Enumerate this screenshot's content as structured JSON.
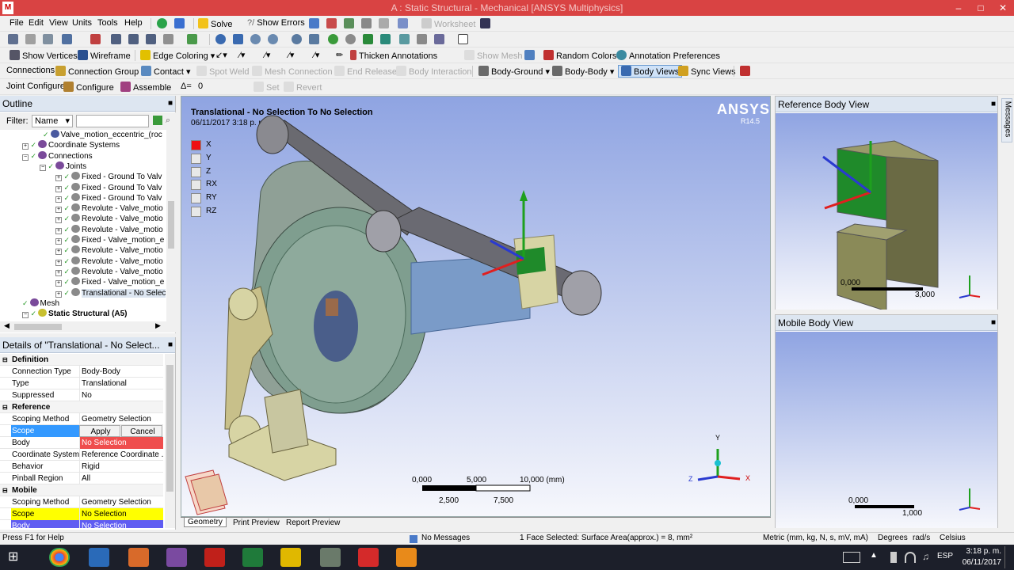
{
  "window": {
    "title": "A : Static Structural - Mechanical [ANSYS Multiphysics]",
    "logo": "M"
  },
  "menu": [
    "File",
    "Edit",
    "View",
    "Units",
    "Tools",
    "Help"
  ],
  "toolbar1": {
    "solve": "Solve",
    "show_errors": "Show Errors",
    "worksheet": "Worksheet"
  },
  "toolbar3": {
    "show_vertices": "Show Vertices",
    "wireframe": "Wireframe",
    "edge_coloring": "Edge Coloring",
    "thicken_annotations": "Thicken Annotations",
    "show_mesh": "Show Mesh",
    "random_colors": "Random Colors",
    "annotation_preferences": "Annotation Preferences"
  },
  "toolbar4": {
    "connections": "Connections",
    "connection_group": "Connection Group",
    "contact": "Contact",
    "spot_weld": "Spot Weld",
    "mesh_connection": "Mesh Connection",
    "end_release": "End Release",
    "body_interaction": "Body Interaction",
    "body_ground": "Body-Ground",
    "body_body": "Body-Body",
    "body_views": "Body Views",
    "sync_views": "Sync Views"
  },
  "toolbar5": {
    "joint_configure": "Joint Configure",
    "configure": "Configure",
    "assemble": "Assemble",
    "delta": "Δ=",
    "delta_value": "0",
    "set": "Set",
    "revert": "Revert"
  },
  "outline": {
    "title": "Outline",
    "filter_label": "Filter:",
    "filter_value": "Name",
    "items": [
      {
        "label": "Valve_motion_eccentric_(roc",
        "indent": 60
      },
      {
        "label": "Coordinate Systems",
        "indent": 34
      },
      {
        "label": "Connections",
        "indent": 34
      },
      {
        "label": "Joints",
        "indent": 56
      },
      {
        "label": "Fixed - Ground To Valv",
        "indent": 76
      },
      {
        "label": "Fixed - Ground To Valv",
        "indent": 76
      },
      {
        "label": "Fixed - Ground To Valv",
        "indent": 76
      },
      {
        "label": "Revolute - Valve_motio",
        "indent": 76
      },
      {
        "label": "Revolute - Valve_motio",
        "indent": 76
      },
      {
        "label": "Revolute - Valve_motio",
        "indent": 76
      },
      {
        "label": "Fixed - Valve_motion_e",
        "indent": 76
      },
      {
        "label": "Revolute - Valve_motio",
        "indent": 76
      },
      {
        "label": "Revolute - Valve_motio",
        "indent": 76
      },
      {
        "label": "Revolute - Valve_motio",
        "indent": 76
      },
      {
        "label": "Fixed - Valve_motion_e",
        "indent": 76
      },
      {
        "label": "Translational - No Selec",
        "indent": 76
      },
      {
        "label": "Mesh",
        "indent": 34
      },
      {
        "label": "Static Structural (A5)",
        "indent": 34
      }
    ]
  },
  "details": {
    "title": "Details of \"Translational - No Select...",
    "rows": [
      {
        "k": "Definition",
        "v": "",
        "sec": true
      },
      {
        "k": "Connection Type",
        "v": "Body-Body"
      },
      {
        "k": "Type",
        "v": "Translational"
      },
      {
        "k": "Suppressed",
        "v": "No"
      },
      {
        "k": "Reference",
        "v": "",
        "sec": true
      },
      {
        "k": "Scoping Method",
        "v": "Geometry Selection"
      },
      {
        "k": "Scope",
        "v": "",
        "scope": true
      },
      {
        "k": "Body",
        "v": "No Selection",
        "red": true
      },
      {
        "k": "Coordinate System",
        "v": "Reference Coordinate ..."
      },
      {
        "k": "Behavior",
        "v": "Rigid"
      },
      {
        "k": "Pinball Region",
        "v": "All"
      },
      {
        "k": "Mobile",
        "v": "",
        "sec": true
      },
      {
        "k": "Scoping Method",
        "v": "Geometry Selection"
      },
      {
        "k": "Scope",
        "v": "No Selection",
        "yellow": true
      },
      {
        "k": "Body",
        "v": "No Selection",
        "blue": true
      }
    ],
    "apply": "Apply",
    "cancel": "Cancel"
  },
  "viewport": {
    "title": "Translational - No Selection To No Selection",
    "date": "06/11/2017 3:18 p. m.",
    "brand": "ANSYS",
    "version": "R14.5",
    "dofs": [
      "X",
      "Y",
      "Z",
      "RX",
      "RY",
      "RZ"
    ],
    "ruler_top": [
      "0,000",
      "5,000",
      "10,000 (mm)"
    ],
    "ruler_bottom": [
      "2,500",
      "7,500"
    ],
    "triad": {
      "x": "X",
      "y": "Y",
      "z": "Z"
    },
    "tabs": [
      "Geometry",
      "Print Preview",
      "Report Preview"
    ]
  },
  "reference_view": {
    "title": "Reference Body View",
    "ruler_left": "0,000",
    "ruler_right": "3,000"
  },
  "mobile_view": {
    "title": "Mobile Body View",
    "ruler_left": "0,000",
    "ruler_right": "1,000"
  },
  "messages_tab": "Messages",
  "status": {
    "help": "Press F1 for Help",
    "messages": "No Messages",
    "selection": "1 Face Selected: Surface Area(approx.) = 8, mm²",
    "units": "Metric (mm, kg, N, s, mV, mA)",
    "angle": "Degrees",
    "ang_vel": "rad/s",
    "temp": "Celsius"
  },
  "taskbar": {
    "lang": "ESP",
    "time": "3:18 p. m.",
    "date": "06/11/2017"
  },
  "colors": {
    "accent": "#d94343",
    "header": "#dde6f1",
    "body_red": "#ef4d4d",
    "scope_yellow": "#ffff00",
    "scope_blue": "#5f5cf2",
    "model_green": "#7f9e8f",
    "model_tan": "#d7d4a4"
  }
}
